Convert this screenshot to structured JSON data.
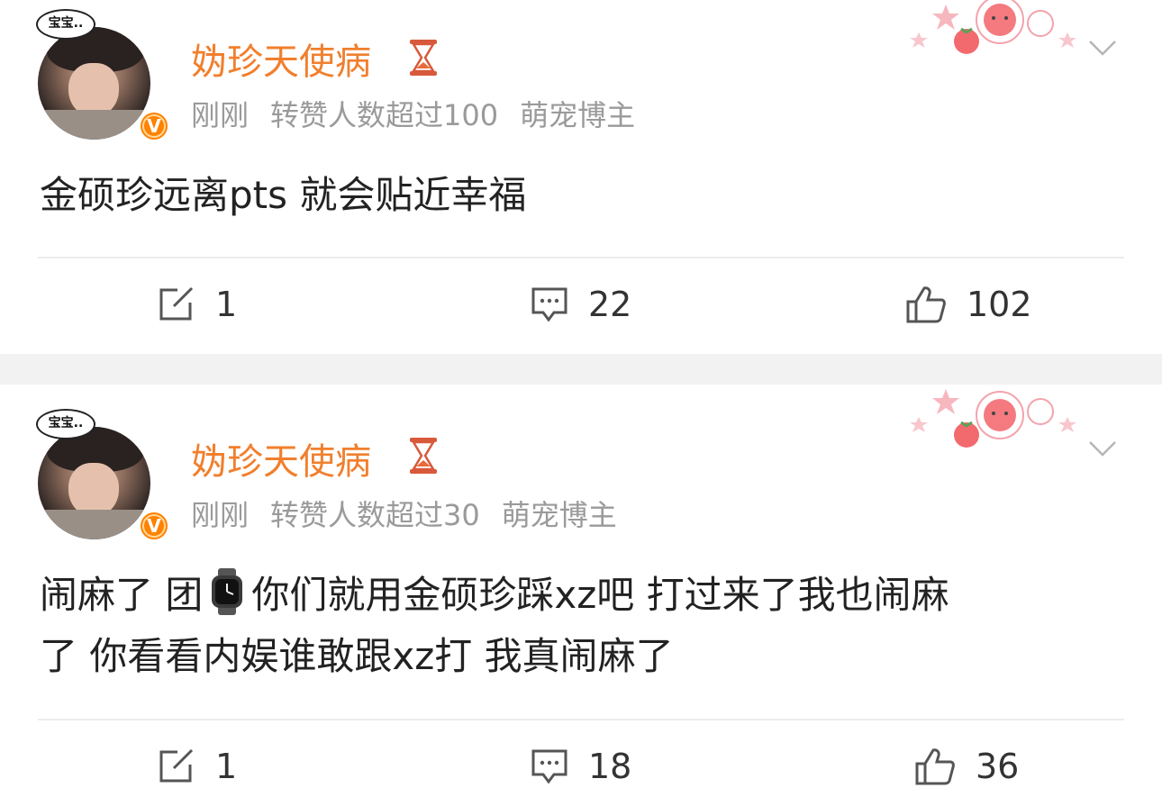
{
  "posts": [
    {
      "avatar_bubble": "宝宝..",
      "username": "妫珍天使病",
      "time": "刚刚",
      "repost_info": "转赞人数超过100",
      "tag": "萌宠博主",
      "content": "金硕珍远离pts 就会贴近幸福",
      "actions": {
        "share": "1",
        "comment": "22",
        "like": "102"
      }
    },
    {
      "avatar_bubble": "宝宝..",
      "username": "妫珍天使病",
      "time": "刚刚",
      "repost_info": "转赞人数超过30",
      "tag": "萌宠博主",
      "content_line1_a": "闹麻了 团",
      "content_line1_b": "你们就用金硕珍踩xz吧 打过来了我也闹麻",
      "content_line2": "了 你看看内娱谁敢跟xz打 我真闹麻了",
      "actions": {
        "share": "1",
        "comment": "18",
        "like": "36"
      }
    }
  ],
  "icons": {
    "verified": "V",
    "share": "share-edit-icon",
    "comment": "comment-icon",
    "like": "thumbs-up-icon",
    "more": "chevron-down-icon",
    "badge": "hourglass-icon"
  },
  "colors": {
    "username": "#f17f2d",
    "meta": "#9a9a9a",
    "verified": "#ff8200",
    "separator": "#f2f2f2"
  }
}
